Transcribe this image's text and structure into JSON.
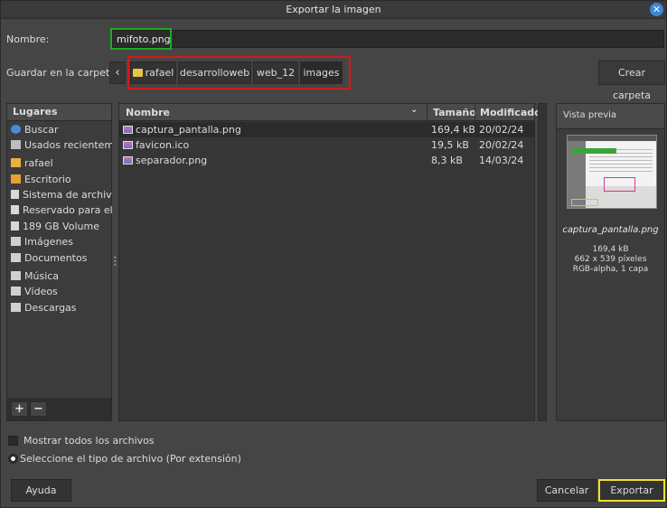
{
  "window": {
    "title": "Exportar la imagen"
  },
  "name_row": {
    "label": "Nombre:",
    "value": "mifoto.png"
  },
  "folder_row": {
    "label": "Guardar en la carpeta:",
    "back_glyph": "‹",
    "breadcrumbs": [
      "rafael",
      "desarrolloweb",
      "web_12",
      "images"
    ],
    "create_folder_label": "Crear carpeta"
  },
  "places": {
    "header": "Lugares",
    "items": [
      {
        "label": "Buscar",
        "icon": "search-icon"
      },
      {
        "label": "Usados recientemente",
        "icon": "recent-icon"
      },
      {
        "label": "rafael",
        "icon": "home-folder-icon"
      },
      {
        "label": "Escritorio",
        "icon": "desktop-icon"
      },
      {
        "label": "Sistema de archivos",
        "icon": "drive-icon"
      },
      {
        "label": "Reservado para el sistema",
        "icon": "drive-icon"
      },
      {
        "label": "189 GB Volume",
        "icon": "drive-icon"
      },
      {
        "label": "Imágenes",
        "icon": "folder-icon"
      },
      {
        "label": "Documentos",
        "icon": "folder-icon"
      },
      {
        "label": "Música",
        "icon": "folder-icon"
      },
      {
        "label": "Vídeos",
        "icon": "folder-icon"
      },
      {
        "label": "Descargas",
        "icon": "folder-icon"
      }
    ],
    "add_label": "+",
    "remove_label": "−"
  },
  "files": {
    "columns": {
      "name": "Nombre",
      "size": "Tamaño",
      "modified": "Modificado"
    },
    "rows": [
      {
        "name": "captura_pantalla.png",
        "size": "169,4 kB",
        "modified": "20/02/24",
        "selected": true
      },
      {
        "name": "favicon.ico",
        "size": "19,5 kB",
        "modified": "20/02/24",
        "selected": false
      },
      {
        "name": "separador.png",
        "size": "8,3 kB",
        "modified": "14/03/24",
        "selected": false
      }
    ]
  },
  "preview": {
    "header": "Vista previa",
    "file_name": "captura_pantalla.png",
    "size": "169,4 kB",
    "dimensions": "662 x 539 píxeles",
    "mode": "RGB-alpha, 1 capa"
  },
  "options": {
    "show_all_files": "Mostrar todos los archivos",
    "file_type": "Seleccione el tipo de archivo (Por extensión)"
  },
  "buttons": {
    "help": "Ayuda",
    "cancel": "Cancelar",
    "export": "Exportar"
  },
  "colors": {
    "name_highlight": "#1faa1f",
    "breadcrumb_highlight": "#d11a1a",
    "export_highlight": "#f0e02a"
  }
}
